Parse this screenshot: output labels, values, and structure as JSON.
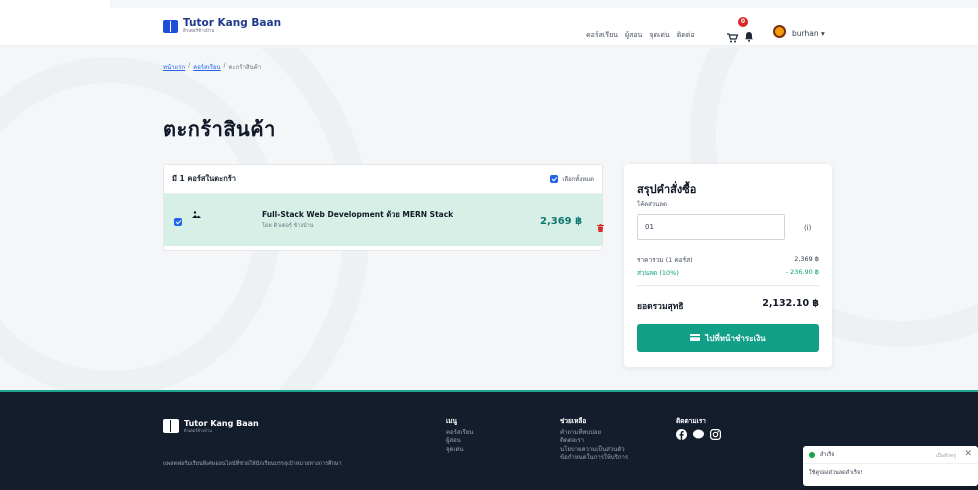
{
  "brand": {
    "name": "Tutor Kang Baan",
    "sub": "ติวเตอร์ข้างบ้าน"
  },
  "nav": {
    "links": [
      "คอร์สเรียน",
      "ผู้สอน",
      "จุดเด่น",
      "ติดต่อ"
    ],
    "cart_count": "0",
    "username": "burhan ▾"
  },
  "breadcrumb": {
    "home": "หน้าแรก",
    "courses": "คอร์สเรียน",
    "current": "ตะกร้าสินค้า",
    "sep": "/"
  },
  "page_title": "ตะกร้าสินค้า",
  "cart": {
    "header": "มี 1 คอร์สในตะกร้า",
    "select_all": "เลือกทั้งหมด",
    "items": [
      {
        "title": "Full-Stack Web Development ด้วย MERN Stack",
        "by": "โดย ติวเตอร์ ข้างบ้าน",
        "price": "2,369 ฿"
      }
    ]
  },
  "summary": {
    "title": "สรุปคำสั่งซื้อ",
    "coupon_label": "โค้ดส่วนลด",
    "coupon_value": "01",
    "coupon_unit": "(i)",
    "subtotal_label": "ราคารวม (1 คอร์ส)",
    "subtotal_value": "2,369 ฿",
    "discount_label": "ส่วนลด (10%)",
    "discount_value": "- 236.90 ฿",
    "net_label": "ยอดรวมสุทธิ",
    "net_value": "2,132.10 ฿",
    "pay_button": "ไปที่หน้าชำระเงิน"
  },
  "footer": {
    "brand_name": "Tutor Kang Baan",
    "brand_sub": "ติวเตอร์ข้างบ้าน",
    "description": "แพลตฟอร์มเรียนพิเศษออนไลน์ที่ช่วยให้นักเรียนบรรลุเป้าหมายทางการศึกษา",
    "menu_head": "เมนู",
    "menu": [
      "คอร์สเรียน",
      "ผู้สอน",
      "จุดเด่น"
    ],
    "help_head": "ช่วยเหลือ",
    "help": [
      "คำถามที่พบบ่อย",
      "ติดต่อเรา",
      "นโยบายความเป็นส่วนตัว",
      "ข้อกำหนดในการให้บริการ"
    ],
    "follow_head": "ติดตามเรา"
  },
  "toast": {
    "title": "สำเร็จ",
    "time": "เมื่อสักครู่",
    "close": "✕",
    "message": "ใช้คูปองส่วนลดสำเร็จ!"
  },
  "colors": {
    "accent": "#129f87",
    "brand": "#1e3a8a",
    "footer_bg": "#141d2c",
    "danger": "#dc2626"
  }
}
